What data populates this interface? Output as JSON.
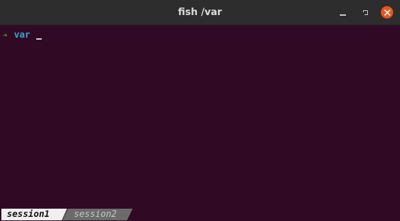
{
  "window": {
    "title": "fish /var",
    "controls": {
      "minimize_icon": "minimize-icon",
      "maximize_icon": "maximize-icon",
      "close_icon": "close-icon"
    }
  },
  "terminal": {
    "prompt_symbol": "➜",
    "current_dir": "var",
    "input_value": ""
  },
  "tabs": [
    {
      "label": "session1",
      "active": true
    },
    {
      "label": "session2",
      "active": false
    }
  ],
  "colors": {
    "background": "#300a24",
    "titlebar": "#2d2d2d",
    "close_button": "#e95420",
    "prompt_arrow": "#4e9a06",
    "directory": "#34a8c8",
    "active_tab": "#f0f0f0",
    "inactive_tab": "#6b6b6b"
  }
}
